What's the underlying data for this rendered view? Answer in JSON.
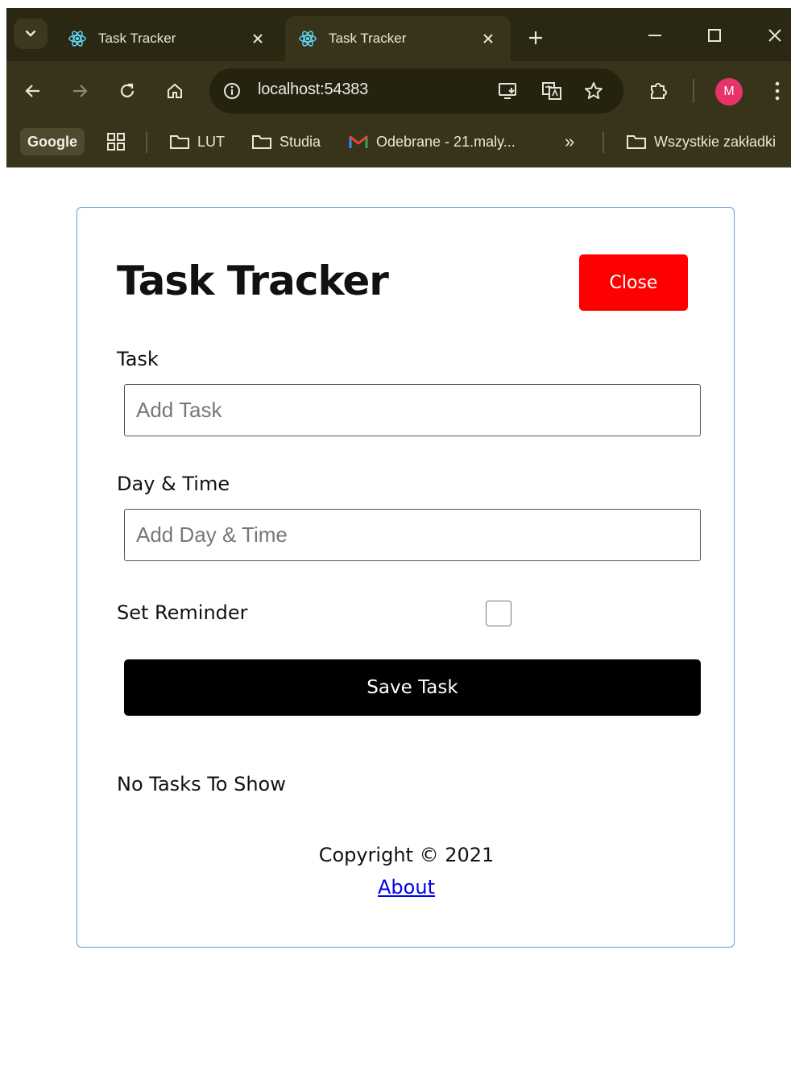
{
  "browser": {
    "tabs": [
      {
        "title": "Task Tracker",
        "active": false
      },
      {
        "title": "Task Tracker",
        "active": true
      }
    ],
    "url": "localhost:54383",
    "profile_initial": "M",
    "profile_color": "#e8336a",
    "bookmarks": {
      "google_label": "Google",
      "items": [
        {
          "label": "LUT",
          "icon": "folder-icon"
        },
        {
          "label": "Studia",
          "icon": "folder-icon"
        },
        {
          "label": "Odebrane - 21.maly...",
          "icon": "gmail-icon"
        }
      ],
      "overflow_label": "»",
      "all_bookmarks_label": "Wszystkie zakładki"
    }
  },
  "app": {
    "title": "Task Tracker",
    "close_button": "Close",
    "close_button_color": "#ff0000",
    "task_label": "Task",
    "task_placeholder": "Add Task",
    "task_value": "",
    "day_label": "Day & Time",
    "day_placeholder": "Add Day & Time",
    "day_value": "",
    "reminder_label": "Set Reminder",
    "reminder_checked": false,
    "save_button": "Save Task",
    "empty_message": "No Tasks To Show",
    "copyright": "Copyright © 2021",
    "about_link": "About"
  }
}
